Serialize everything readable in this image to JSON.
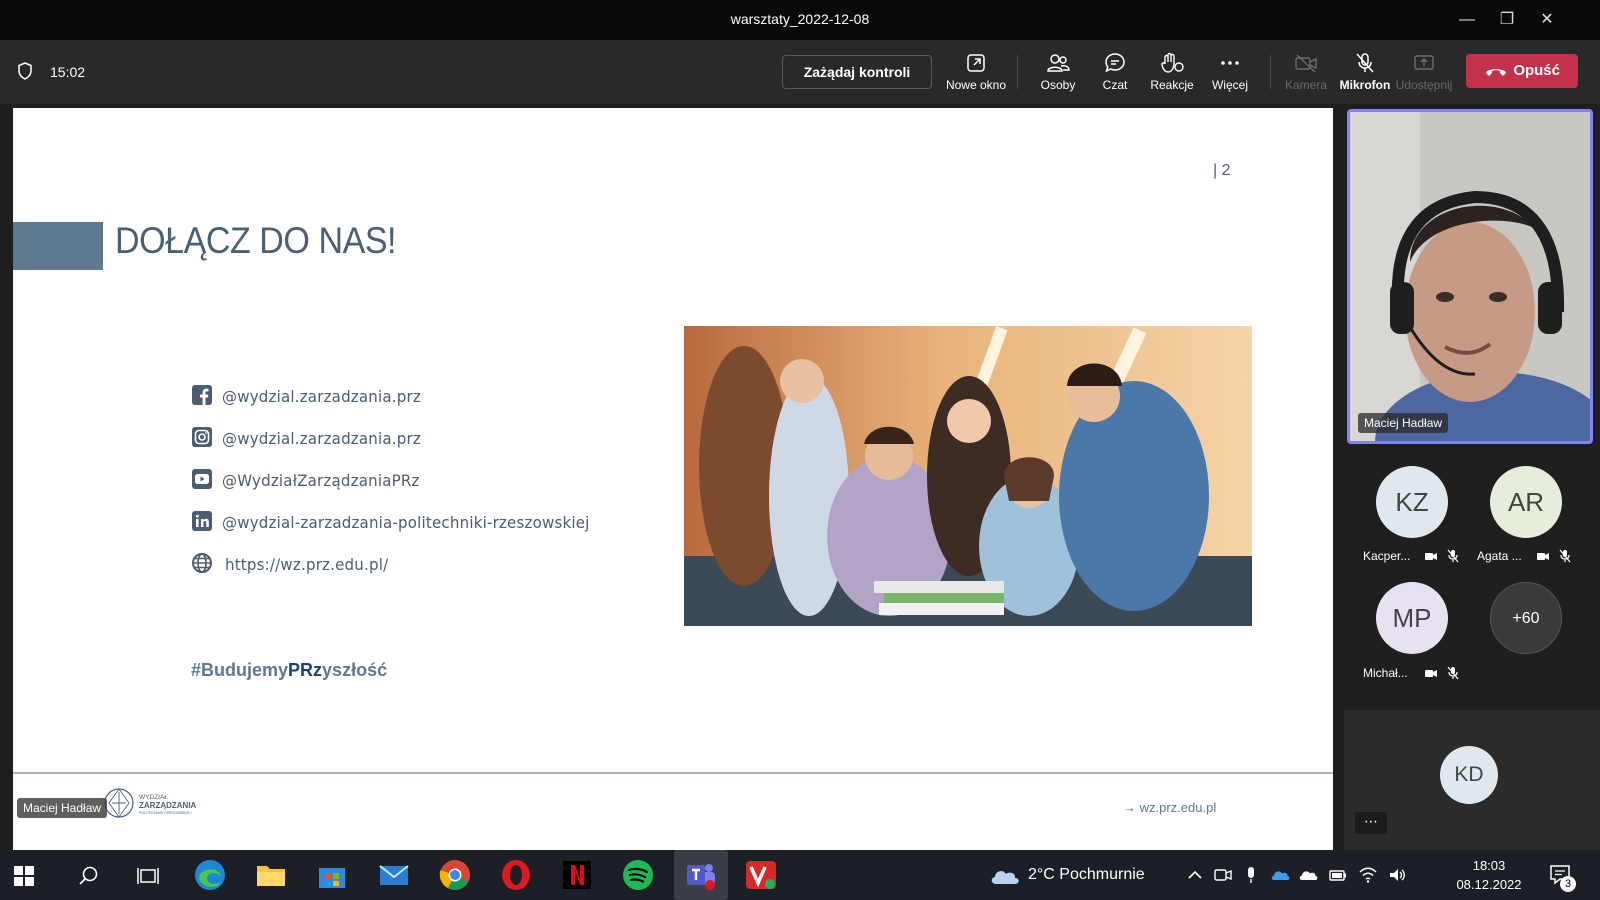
{
  "window": {
    "title": "warsztaty_2022-12-08"
  },
  "toolbar": {
    "timer": "15:02",
    "request_control": "Zażądaj kontroli",
    "new_window": "Nowe okno",
    "people": "Osoby",
    "chat": "Czat",
    "reactions": "Reakcje",
    "more": "Więcej",
    "camera": "Kamera",
    "mic": "Mikrofon",
    "share": "Udostępnij",
    "leave": "Opuść"
  },
  "slide": {
    "page_number": "| 2",
    "title": "DOŁĄCZ DO NAS!",
    "links": [
      {
        "icon": "facebook-icon",
        "text": "@wydzial.zarzadzania.prz"
      },
      {
        "icon": "instagram-icon",
        "text": "@wydzial.zarzadzania.prz"
      },
      {
        "icon": "youtube-icon",
        "text": "@WydziałZarządzaniaPRz"
      },
      {
        "icon": "linkedin-icon",
        "text": "@wydzial-zarzadzania-politechniki-rzeszowskiej"
      },
      {
        "icon": "globe-icon",
        "text": "https://wz.prz.edu.pl/"
      }
    ],
    "hashtag_pre": "#Budujemy",
    "hashtag_mid": "PRz",
    "hashtag_post": "yszłość",
    "footer_url": "→ wz.prz.edu.pl",
    "logo_text": "WYDZIAŁ ZARZĄDZANIA POLITECHNIKI RZESZOWSKIEJ",
    "presenter": "Maciej Hadław"
  },
  "participants": {
    "video_name": "Maciej Hadław",
    "list": [
      {
        "initials": "KZ",
        "name": "Kacper...",
        "color": "#dfe8ef"
      },
      {
        "initials": "AR",
        "name": "Agata ...",
        "color": "#e6eedb"
      },
      {
        "initials": "MP",
        "name": "Michał...",
        "color": "#e7e1f1"
      }
    ],
    "overflow": "+60",
    "tile": {
      "initials": "KD",
      "color": "#dfe8ef"
    }
  },
  "taskbar": {
    "weather": "2°C  Pochmurnie",
    "time": "18:03",
    "date": "08.12.2022",
    "notifications": "3"
  },
  "colors": {
    "accent": "#7f85f5",
    "leave": "#c4314b",
    "slide_blue": "#5e7890"
  }
}
